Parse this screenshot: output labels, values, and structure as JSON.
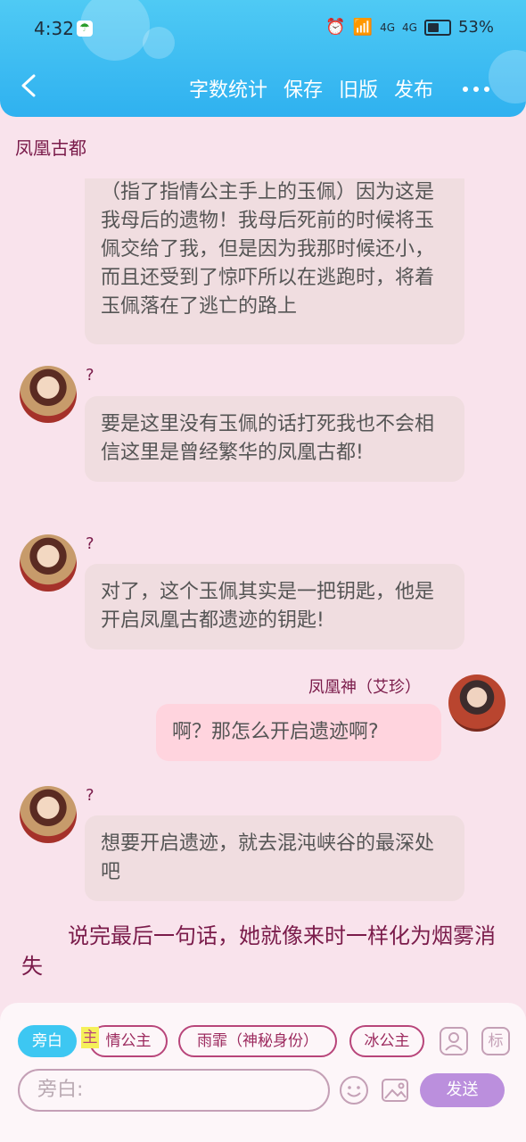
{
  "status_bar": {
    "time": "4:32",
    "battery": "53%",
    "battery_level": 0.53,
    "signal1": "4G",
    "signal2": "4G"
  },
  "header": {
    "actions": [
      "字数统计",
      "保存",
      "旧版",
      "发布"
    ]
  },
  "title": "凤凰古都",
  "messages": [
    {
      "side": "left",
      "sender": "",
      "text": "（指了指情公主手上的玉佩）因为这是我母后的遗物！我母后死前的时候将玉佩交给了我，但是因为我那时候还小，而且还受到了惊吓所以在逃跑时，将着玉佩落在了逃亡的路上"
    },
    {
      "side": "left",
      "sender": "?",
      "text": "要是这里没有玉佩的话打死我也不会相信这里是曾经繁华的凤凰古都!"
    },
    {
      "side": "left",
      "sender": "?",
      "text": "对了，这个玉佩其实是一把钥匙，他是开启凤凰古都遗迹的钥匙!"
    },
    {
      "side": "right",
      "sender": "凤凰神（艾珍）",
      "text": "啊？那怎么开启遗迹啊?"
    },
    {
      "side": "left",
      "sender": "?",
      "text": "想要开启遗迹，就去混沌峡谷的最深处吧"
    }
  ],
  "narration": "说完最后一句话，她就像来时一样化为烟雾消失",
  "role_chips": [
    {
      "label": "旁白",
      "active": true
    },
    {
      "label": "情公主",
      "active": false
    },
    {
      "label": "雨霏（神秘身份）",
      "active": false
    },
    {
      "label": "冰公主",
      "active": false
    }
  ],
  "zhu_tag": "主",
  "tag_button": "标",
  "input": {
    "placeholder": "旁白:"
  },
  "send_label": "发送",
  "colors": {
    "header": "#2fb1f0",
    "accent": "#7a1b4a",
    "send": "#bb8fdd",
    "background": "#f9e3ec"
  }
}
